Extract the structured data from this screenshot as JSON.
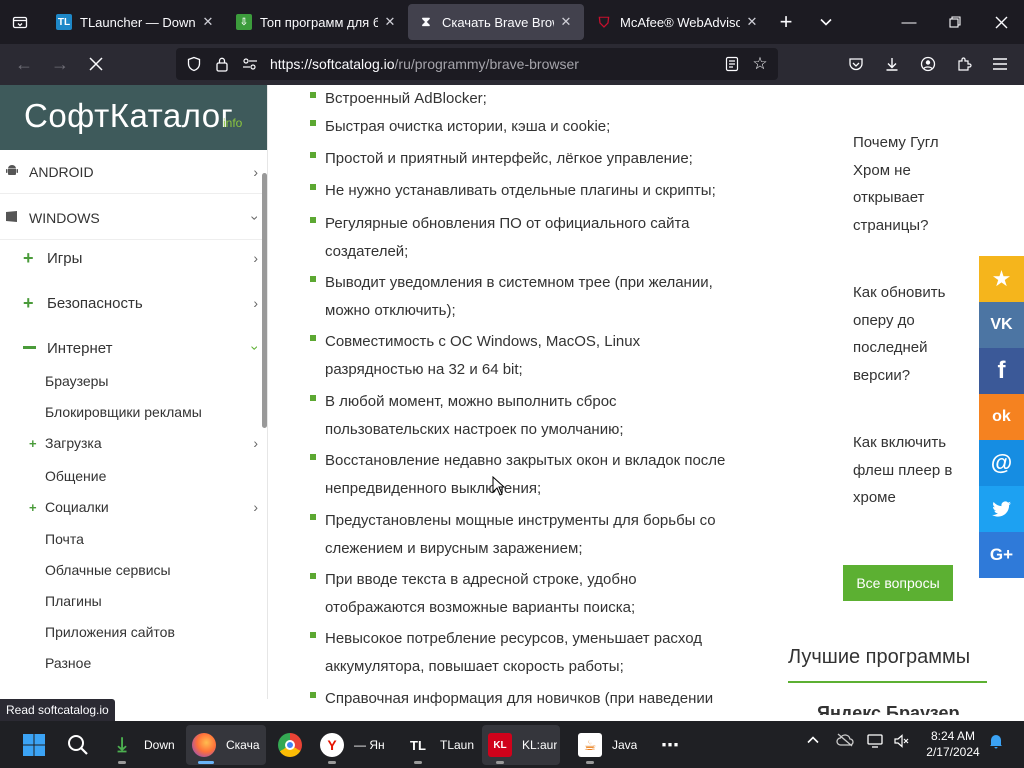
{
  "browser": {
    "tabs": [
      {
        "label": "TLauncher — Downloa",
        "favicon": "TL",
        "active": false
      },
      {
        "label": "Топ программ для бл",
        "favicon": "download",
        "active": false
      },
      {
        "label": "Скачать Brave Browser",
        "favicon": "hourglass",
        "active": true
      },
      {
        "label": "McAfee® WebAdvisor",
        "favicon": "mcafee",
        "active": false
      }
    ],
    "url_domain": "https://softcatalog.io",
    "url_path": "/ru/programmy/brave-browser",
    "status_text": "Read softcatalog.io"
  },
  "sidebar": {
    "logo_main": "СофтКаталог",
    "logo_sub": "info",
    "top_items": [
      {
        "label": "ANDROID"
      },
      {
        "label": "WINDOWS"
      }
    ],
    "sections": [
      {
        "label": "Игры"
      },
      {
        "label": "Безопасность"
      },
      {
        "label": "Интернет"
      }
    ],
    "internet_items": [
      {
        "label": "Браузеры"
      },
      {
        "label": "Блокировщики рекламы"
      },
      {
        "label": "Загрузка"
      },
      {
        "label": "Общение"
      },
      {
        "label": "Социалки"
      },
      {
        "label": "Почта"
      },
      {
        "label": "Облачные сервисы"
      },
      {
        "label": "Плагины"
      },
      {
        "label": "Приложения сайтов"
      },
      {
        "label": "Разное"
      }
    ]
  },
  "features": [
    "Встроенный AdBlocker;",
    "Быстрая очистка истории, кэша и cookie;",
    "Простой и приятный интерфейс, лёгкое управление;",
    "Не нужно устанавливать отдельные плагины и скрипты;",
    "Регулярные обновления ПО от официального сайта создателей;",
    "Выводит уведомления в системном трее (при желании, можно отключить);",
    "Совместимость с ОС Windows, MacOS, Linux разрядностью на 32 и 64 bit;",
    "В любой момент, можно выполнить сброс пользовательских настроек по умолчанию;",
    "Восстановление недавно закрытых окон и вкладок после непредвиденного выключения;",
    "Предустановлены мощные инструменты для борьбы со слежением и вирусным заражением;",
    "При вводе текста в адресной строке, удобно отображаются возможные варианты поиска;",
    "Невысокое потребление ресурсов, уменьшает расход аккумулятора, повышает скорость работы;",
    "Справочная информация для новичков (при наведении"
  ],
  "questions": [
    "Почему Гугл Хром не открывает страницы?",
    "Как обновить оперу до последней версии?",
    "Как включить флеш плеер в хроме"
  ],
  "all_questions_label": "Все вопросы",
  "best_programs_title": "Лучшие программы",
  "best_program_item": "Яндекс Браузер",
  "social": [
    {
      "icon": "star-icon",
      "glyph": "★",
      "color": "#f5b51c"
    },
    {
      "icon": "vk-icon",
      "glyph": "VK",
      "color": "#4c75a3"
    },
    {
      "icon": "facebook-icon",
      "glyph": "f",
      "color": "#3b5998"
    },
    {
      "icon": "odnoklassniki-icon",
      "glyph": "ok",
      "color": "#f58220"
    },
    {
      "icon": "mail-icon",
      "glyph": "@",
      "color": "#168de2"
    },
    {
      "icon": "twitter-icon",
      "glyph": "t",
      "color": "#1da1f2"
    },
    {
      "icon": "google-plus-icon",
      "glyph": "G+",
      "color": "#2f7ad9"
    }
  ],
  "taskbar": {
    "apps": [
      {
        "label": "Down"
      },
      {
        "label": "Скача"
      },
      {
        "label": ""
      },
      {
        "label": "— Ян"
      },
      {
        "label": "TLaun"
      },
      {
        "label": "KL:aur"
      },
      {
        "label": "Java"
      }
    ],
    "time": "8:24 AM",
    "date": "2/17/2024"
  },
  "colors": {
    "accent_green": "#5cb032",
    "logo_bg": "#3e5a5b",
    "browser_dark": "#1c1b22"
  }
}
